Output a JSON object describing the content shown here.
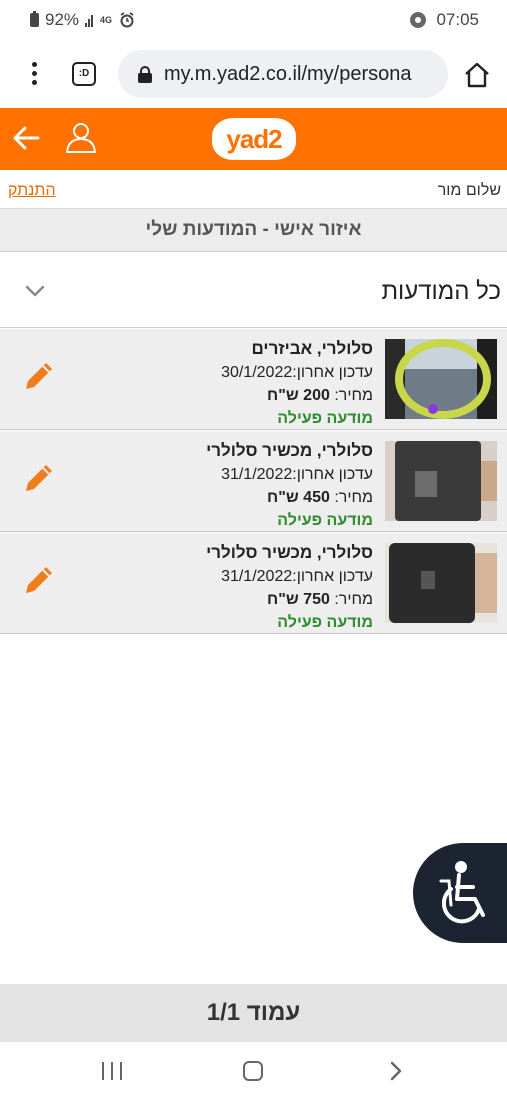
{
  "status_bar": {
    "battery": "92%",
    "network": "4G",
    "time": "07:05"
  },
  "browser": {
    "url": "my.m.yad2.co.il/my/persona",
    "tab_label": ":D"
  },
  "header": {
    "logo_text": "yad2",
    "brand_color": "#ff7100"
  },
  "greeting": {
    "text": "שלום מור",
    "logout": "התנתק"
  },
  "section_title": "איזור אישי - המודעות שלי",
  "filter": {
    "label": "כל המודעות"
  },
  "listings": [
    {
      "title": "סלולרי, אביזרים",
      "updated_label": "עדכון אחרון:",
      "updated_date": "30/1/2022",
      "price_label": "מחיר:",
      "price_value": "200 ש\"ח",
      "status": "מודעה פעילה"
    },
    {
      "title": "סלולרי, מכשיר סלולרי",
      "updated_label": "עדכון אחרון:",
      "updated_date": "31/1/2022",
      "price_label": "מחיר:",
      "price_value": "450 ש\"ח",
      "status": "מודעה פעילה"
    },
    {
      "title": "סלולרי, מכשיר סלולרי",
      "updated_label": "עדכון אחרון:",
      "updated_date": "31/1/2022",
      "price_label": "מחיר:",
      "price_value": "750 ש\"ח",
      "status": "מודעה פעילה"
    }
  ],
  "pager": {
    "text": "עמוד 1/1"
  },
  "icons": {
    "back": "arrow-left-icon",
    "user": "user-icon",
    "edit": "pencil-icon",
    "accessibility": "wheelchair-icon"
  }
}
